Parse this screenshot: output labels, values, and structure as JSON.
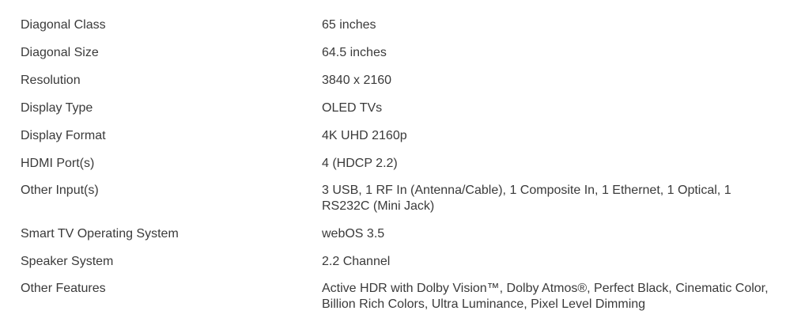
{
  "specs": [
    {
      "label": "Diagonal Class",
      "value": "65 inches"
    },
    {
      "label": "Diagonal Size",
      "value": "64.5 inches"
    },
    {
      "label": "Resolution",
      "value": "3840 x 2160"
    },
    {
      "label": "Display Type",
      "value": "OLED TVs"
    },
    {
      "label": "Display Format",
      "value": "4K UHD 2160p"
    },
    {
      "label": "HDMI Port(s)",
      "value": "4 (HDCP 2.2)"
    },
    {
      "label": "Other Input(s)",
      "value": "3 USB, 1 RF In (Antenna/Cable), 1 Composite In, 1 Ethernet, 1 Optical, 1 RS232C (Mini Jack)"
    },
    {
      "label": "Smart TV Operating System",
      "value": "webOS 3.5"
    },
    {
      "label": "Speaker System",
      "value": "2.2 Channel"
    },
    {
      "label": "Other Features",
      "value": "Active HDR with Dolby Vision™, Dolby Atmos®, Perfect Black, Cinematic Color, Billion Rich Colors, Ultra Luminance, Pixel Level Dimming"
    }
  ]
}
